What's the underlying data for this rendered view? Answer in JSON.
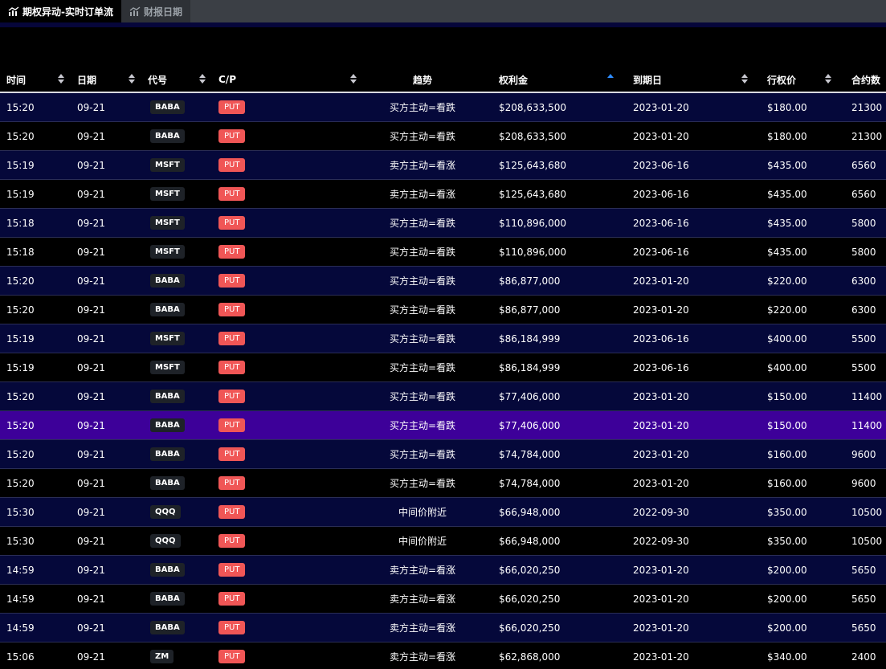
{
  "tabs": [
    {
      "label": "期权异动-实时订单流",
      "active": true
    },
    {
      "label": "财报日期",
      "active": false
    }
  ],
  "columns": [
    {
      "key": "time",
      "label": "时间",
      "sort": "both"
    },
    {
      "key": "date",
      "label": "日期",
      "sort": "both"
    },
    {
      "key": "code",
      "label": "代号",
      "sort": "both"
    },
    {
      "key": "cp",
      "label": "C/P",
      "sort": "both"
    },
    {
      "key": "trend",
      "label": "趋势",
      "sort": "none"
    },
    {
      "key": "premium",
      "label": "权利金",
      "sort": "asc"
    },
    {
      "key": "expiry",
      "label": "到期日",
      "sort": "both"
    },
    {
      "key": "strike",
      "label": "行权价",
      "sort": "both"
    },
    {
      "key": "contracts",
      "label": "合约数",
      "sort": "none"
    }
  ],
  "trend_colors": {
    "bear": "#f05656",
    "bull": "#34b34a",
    "mid": "#ffffff"
  },
  "rows": [
    {
      "time": "15:20",
      "date": "09-21",
      "code": "BABA",
      "cp": "PUT",
      "trend": "买方主动=看跌",
      "trend_type": "bear",
      "premium": "$208,633,500",
      "expiry": "2023-01-20",
      "strike": "$180.00",
      "contracts": "21300"
    },
    {
      "time": "15:20",
      "date": "09-21",
      "code": "BABA",
      "cp": "PUT",
      "trend": "买方主动=看跌",
      "trend_type": "bear",
      "premium": "$208,633,500",
      "expiry": "2023-01-20",
      "strike": "$180.00",
      "contracts": "21300"
    },
    {
      "time": "15:19",
      "date": "09-21",
      "code": "MSFT",
      "cp": "PUT",
      "trend": "卖方主动=看涨",
      "trend_type": "bull",
      "premium": "$125,643,680",
      "expiry": "2023-06-16",
      "strike": "$435.00",
      "contracts": "6560"
    },
    {
      "time": "15:19",
      "date": "09-21",
      "code": "MSFT",
      "cp": "PUT",
      "trend": "卖方主动=看涨",
      "trend_type": "bull",
      "premium": "$125,643,680",
      "expiry": "2023-06-16",
      "strike": "$435.00",
      "contracts": "6560"
    },
    {
      "time": "15:18",
      "date": "09-21",
      "code": "MSFT",
      "cp": "PUT",
      "trend": "买方主动=看跌",
      "trend_type": "bear",
      "premium": "$110,896,000",
      "expiry": "2023-06-16",
      "strike": "$435.00",
      "contracts": "5800"
    },
    {
      "time": "15:18",
      "date": "09-21",
      "code": "MSFT",
      "cp": "PUT",
      "trend": "买方主动=看跌",
      "trend_type": "bear",
      "premium": "$110,896,000",
      "expiry": "2023-06-16",
      "strike": "$435.00",
      "contracts": "5800"
    },
    {
      "time": "15:20",
      "date": "09-21",
      "code": "BABA",
      "cp": "PUT",
      "trend": "买方主动=看跌",
      "trend_type": "bear",
      "premium": "$86,877,000",
      "expiry": "2023-01-20",
      "strike": "$220.00",
      "contracts": "6300"
    },
    {
      "time": "15:20",
      "date": "09-21",
      "code": "BABA",
      "cp": "PUT",
      "trend": "买方主动=看跌",
      "trend_type": "bear",
      "premium": "$86,877,000",
      "expiry": "2023-01-20",
      "strike": "$220.00",
      "contracts": "6300"
    },
    {
      "time": "15:19",
      "date": "09-21",
      "code": "MSFT",
      "cp": "PUT",
      "trend": "买方主动=看跌",
      "trend_type": "bear",
      "premium": "$86,184,999",
      "expiry": "2023-06-16",
      "strike": "$400.00",
      "contracts": "5500"
    },
    {
      "time": "15:19",
      "date": "09-21",
      "code": "MSFT",
      "cp": "PUT",
      "trend": "买方主动=看跌",
      "trend_type": "bear",
      "premium": "$86,184,999",
      "expiry": "2023-06-16",
      "strike": "$400.00",
      "contracts": "5500"
    },
    {
      "time": "15:20",
      "date": "09-21",
      "code": "BABA",
      "cp": "PUT",
      "trend": "买方主动=看跌",
      "trend_type": "bear",
      "premium": "$77,406,000",
      "expiry": "2023-01-20",
      "strike": "$150.00",
      "contracts": "11400"
    },
    {
      "time": "15:20",
      "date": "09-21",
      "code": "BABA",
      "cp": "PUT",
      "trend": "买方主动=看跌",
      "trend_type": "bear",
      "premium": "$77,406,000",
      "expiry": "2023-01-20",
      "strike": "$150.00",
      "contracts": "11400",
      "highlighted": true
    },
    {
      "time": "15:20",
      "date": "09-21",
      "code": "BABA",
      "cp": "PUT",
      "trend": "买方主动=看跌",
      "trend_type": "bear",
      "premium": "$74,784,000",
      "expiry": "2023-01-20",
      "strike": "$160.00",
      "contracts": "9600"
    },
    {
      "time": "15:20",
      "date": "09-21",
      "code": "BABA",
      "cp": "PUT",
      "trend": "买方主动=看跌",
      "trend_type": "bear",
      "premium": "$74,784,000",
      "expiry": "2023-01-20",
      "strike": "$160.00",
      "contracts": "9600"
    },
    {
      "time": "15:30",
      "date": "09-21",
      "code": "QQQ",
      "cp": "PUT",
      "trend": "中间价附近",
      "trend_type": "mid",
      "premium": "$66,948,000",
      "expiry": "2022-09-30",
      "strike": "$350.00",
      "contracts": "10500"
    },
    {
      "time": "15:30",
      "date": "09-21",
      "code": "QQQ",
      "cp": "PUT",
      "trend": "中间价附近",
      "trend_type": "mid",
      "premium": "$66,948,000",
      "expiry": "2022-09-30",
      "strike": "$350.00",
      "contracts": "10500"
    },
    {
      "time": "14:59",
      "date": "09-21",
      "code": "BABA",
      "cp": "PUT",
      "trend": "卖方主动=看涨",
      "trend_type": "bull",
      "premium": "$66,020,250",
      "expiry": "2023-01-20",
      "strike": "$200.00",
      "contracts": "5650"
    },
    {
      "time": "14:59",
      "date": "09-21",
      "code": "BABA",
      "cp": "PUT",
      "trend": "卖方主动=看涨",
      "trend_type": "bull",
      "premium": "$66,020,250",
      "expiry": "2023-01-20",
      "strike": "$200.00",
      "contracts": "5650"
    },
    {
      "time": "14:59",
      "date": "09-21",
      "code": "BABA",
      "cp": "PUT",
      "trend": "卖方主动=看涨",
      "trend_type": "bull",
      "premium": "$66,020,250",
      "expiry": "2023-01-20",
      "strike": "$200.00",
      "contracts": "5650"
    },
    {
      "time": "15:06",
      "date": "09-21",
      "code": "ZM",
      "cp": "PUT",
      "trend": "卖方主动=看涨",
      "trend_type": "bull",
      "premium": "$62,868,000",
      "expiry": "2023-01-20",
      "strike": "$340.00",
      "contracts": "2400"
    }
  ]
}
